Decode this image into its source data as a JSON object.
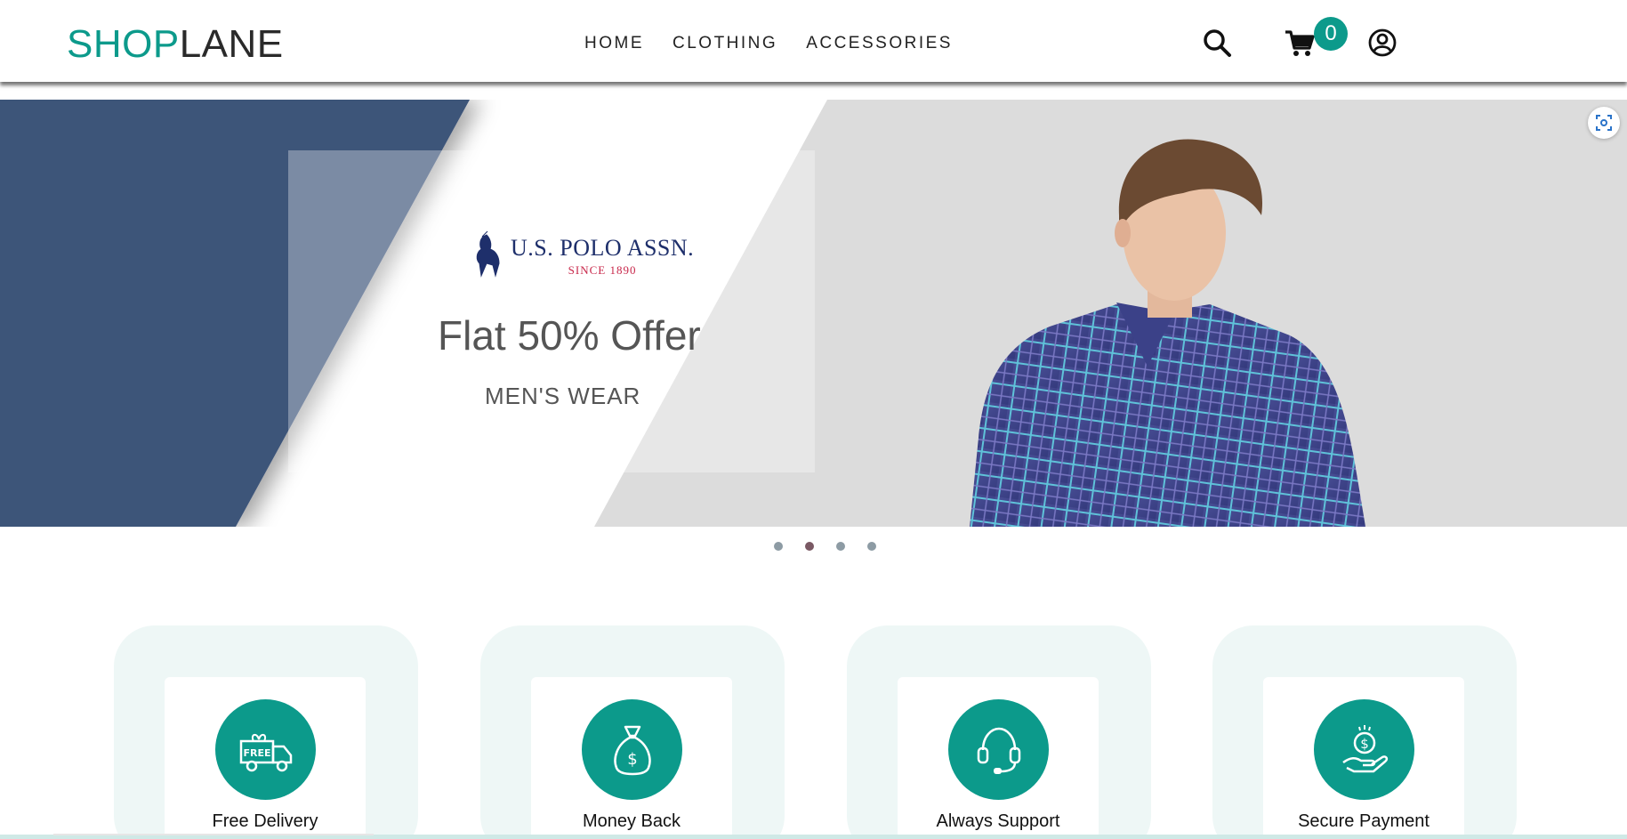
{
  "header": {
    "logo_part1": "SHOP",
    "logo_part2": "LANE",
    "nav": [
      "HOME",
      "CLOTHING",
      "ACCESSORIES"
    ],
    "cart_count": "0",
    "icons": [
      "search-icon",
      "cart-icon",
      "account-icon"
    ]
  },
  "hero": {
    "brand_name": "U.S. POLO ASSN.",
    "brand_since": "SINCE 1890",
    "offer": "Flat 50% Offer",
    "subtitle": "MEN'S WEAR",
    "slides_count": 4,
    "active_slide": 2
  },
  "features": [
    {
      "label": "Free Delivery",
      "icon": "free-delivery-truck-icon"
    },
    {
      "label": "Money Back",
      "icon": "money-bag-icon"
    },
    {
      "label": "Always Support",
      "icon": "headset-icon"
    },
    {
      "label": "Secure Payment",
      "icon": "secure-payment-hand-icon"
    }
  ],
  "colors": {
    "accent": "#0c9a8b",
    "hero_navy": "#3e5479",
    "feature_bg": "#eef7f6"
  }
}
